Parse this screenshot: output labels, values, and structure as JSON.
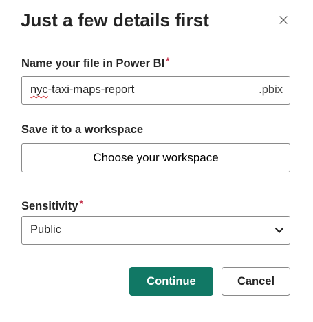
{
  "dialog": {
    "title": "Just a few details first",
    "close_icon": "close-icon"
  },
  "file_name": {
    "label": "Name your file in Power BI",
    "required_mark": "*",
    "value": "nyc-taxi-maps-report",
    "value_misspelled_part": "nyc",
    "value_rest": "-taxi-maps-report",
    "extension": ".pbix"
  },
  "workspace": {
    "label": "Save it to a workspace",
    "button_label": "Choose your workspace"
  },
  "sensitivity": {
    "label": "Sensitivity",
    "required_mark": "*",
    "selected": "Public",
    "chevron_icon": "chevron-down-icon"
  },
  "actions": {
    "continue_label": "Continue",
    "cancel_label": "Cancel"
  },
  "colors": {
    "primary": "#117865",
    "required": "#c4314b",
    "border": "#8a8a8a",
    "text": "#242424"
  }
}
